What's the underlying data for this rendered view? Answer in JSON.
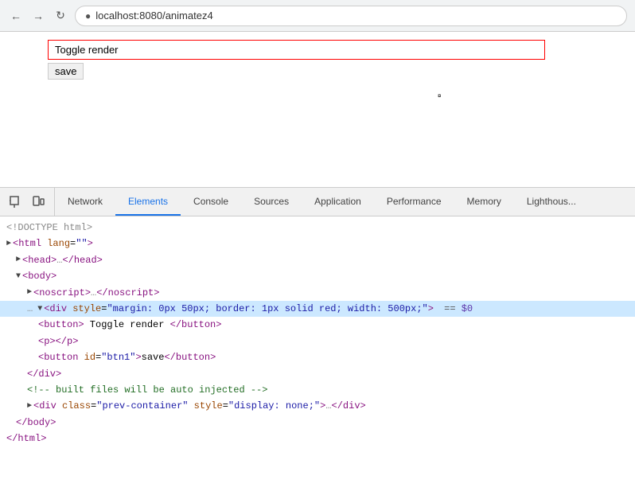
{
  "browser": {
    "url": "localhost:8080/animatez4",
    "back_label": "←",
    "forward_label": "→",
    "reload_label": "↺"
  },
  "page": {
    "toggle_render_label": "Toggle render",
    "save_label": "save"
  },
  "devtools": {
    "tabs": [
      {
        "id": "network",
        "label": "Network",
        "active": false
      },
      {
        "id": "elements",
        "label": "Elements",
        "active": true
      },
      {
        "id": "console",
        "label": "Console",
        "active": false
      },
      {
        "id": "sources",
        "label": "Sources",
        "active": false
      },
      {
        "id": "application",
        "label": "Application",
        "active": false
      },
      {
        "id": "performance",
        "label": "Performance",
        "active": false
      },
      {
        "id": "memory",
        "label": "Memory",
        "active": false
      },
      {
        "id": "lighthouse",
        "label": "Lighthous...",
        "active": false
      }
    ],
    "elements": {
      "lines": [
        {
          "indent": 0,
          "content": "<!DOCTYPE html>",
          "type": "doctype"
        },
        {
          "indent": 0,
          "content": "<html lang=>",
          "type": "tag"
        },
        {
          "indent": 1,
          "content": "▶<head>…</head>",
          "type": "collapsed"
        },
        {
          "indent": 1,
          "content": "▼<body>",
          "type": "expanded"
        },
        {
          "indent": 2,
          "content": "▶<noscript>…</noscript>",
          "type": "collapsed"
        },
        {
          "indent": 2,
          "content": "▼<div style=\"margin: 0px 50px; border: 1px solid red; width: 500px;\"> == $0",
          "type": "highlighted"
        },
        {
          "indent": 3,
          "content": "<button> Toggle render </button>",
          "type": "normal"
        },
        {
          "indent": 3,
          "content": "<p></p>",
          "type": "normal"
        },
        {
          "indent": 3,
          "content": "<button id=\"btn1\">save</button>",
          "type": "normal"
        },
        {
          "indent": 2,
          "content": "</div>",
          "type": "normal"
        },
        {
          "indent": 2,
          "content": "<!-- built files will be auto injected -->",
          "type": "comment"
        },
        {
          "indent": 2,
          "content": "▶<div class=\"prev-container\" style=\"display: none;\">…</div>",
          "type": "collapsed"
        },
        {
          "indent": 1,
          "content": "</body>",
          "type": "normal"
        },
        {
          "indent": 0,
          "content": "</html>",
          "type": "normal"
        }
      ]
    }
  }
}
